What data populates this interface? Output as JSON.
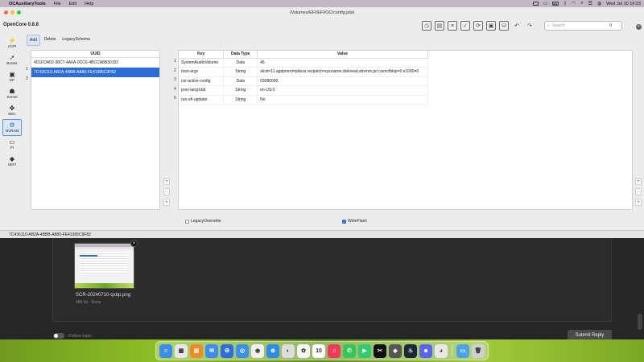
{
  "menubar": {
    "apple": "",
    "app_name": "OCAuxiliaryTools",
    "items": [
      "File",
      "Edit",
      "Help"
    ],
    "input_badge": "FR",
    "clock": "Wed Jul 10  19:23"
  },
  "window": {
    "title": "/Volumes/EFI/EFI/OC/config.plist",
    "app_title": "OpenCore 0.8.8",
    "search_placeholder": "Search",
    "search_count": "0"
  },
  "sidebar": {
    "items": [
      {
        "label": "ACPI",
        "icon": "lightning-icon",
        "active": false
      },
      {
        "label": "Booter",
        "icon": "rocket-icon",
        "active": false
      },
      {
        "label": "DP",
        "icon": "monitor-icon",
        "active": false
      },
      {
        "label": "Kernel",
        "icon": "person-icon",
        "active": false
      },
      {
        "label": "Misc",
        "icon": "misc-icon",
        "active": false
      },
      {
        "label": "NVRAM",
        "icon": "gear-icon",
        "active": true
      },
      {
        "label": "PI",
        "icon": "display-icon",
        "active": false
      },
      {
        "label": "UEFI",
        "icon": "cube-icon",
        "active": false
      }
    ]
  },
  "subtabs": [
    "Add",
    "Delete",
    "LegacySchema"
  ],
  "uuid_panel": {
    "header": "UUID",
    "rows": [
      {
        "num": "1",
        "uuid": "4D1FDA02-38C7-4A6A-9CC6-4BCCA8B30102",
        "selected": false
      },
      {
        "num": "2",
        "uuid": "7C436110-AB2A-4BBB-A880-FE41995C9F82",
        "selected": true
      }
    ]
  },
  "value_table": {
    "headers": {
      "key": "Key",
      "type": "Data Type",
      "value": "Value"
    },
    "rows": [
      {
        "num": "1",
        "key": "SystemAudioVolume",
        "type": "Data",
        "value": "46"
      },
      {
        "num": "2",
        "key": "boot-args",
        "type": "String",
        "value": "alcid=11 agdpmod=pikera revpatch=cpuname,diskread,sbvmm,pci vsmcfbkip=0 e1000=0"
      },
      {
        "num": "3",
        "key": "csr-active-config",
        "type": "Data",
        "value": "03080000"
      },
      {
        "num": "4",
        "key": "prev-lang:kbd",
        "type": "String",
        "value": "en-US:0"
      },
      {
        "num": "5",
        "key": "run-efi-updater",
        "type": "String",
        "value": "No"
      }
    ]
  },
  "buttons": {
    "add": "+",
    "remove": "-",
    "misc": "+"
  },
  "checkboxes": {
    "legacy_overwrite": {
      "label": "LegacyOverwrite",
      "checked": false
    },
    "write_flash": {
      "label": "WriteFlash",
      "checked": true
    }
  },
  "statusbar": {
    "text": "7C436110-AB2A-4BBB-A880-FE41995C9F82"
  },
  "compose": {
    "attachment_name": "SCR-20240710-qxbp.png",
    "attachment_meta": "489 kb · Done",
    "close": "×",
    "follow_label": "Follow topic",
    "submit_label": "Submit Reply"
  },
  "dock": {
    "apps": [
      {
        "name": "finder-icon",
        "color": "#3b8ee8",
        "glyph": "☺"
      },
      {
        "name": "launchpad-icon",
        "color": "#e8e8e8",
        "glyph": "▦"
      },
      {
        "name": "photos-grid-icon",
        "color": "#f08a24",
        "glyph": "▥"
      },
      {
        "name": "mail-icon",
        "color": "#3d8df0",
        "glyph": "✉"
      },
      {
        "name": "settings-icon",
        "color": "#2f6ed8",
        "glyph": "⚙"
      },
      {
        "name": "app-store-icon",
        "color": "#3a8ff0",
        "glyph": "◎"
      },
      {
        "name": "safari-alt-icon",
        "color": "#f0f0f0",
        "glyph": "◉"
      },
      {
        "name": "safari-icon",
        "color": "#2a8be8",
        "glyph": "⊕"
      },
      {
        "name": "chrome-alt-icon",
        "color": "#dddddd",
        "glyph": "◐"
      },
      {
        "name": "photos-icon",
        "color": "#f5f5f5",
        "glyph": "✿"
      },
      {
        "name": "calendar-icon",
        "color": "#ffffff",
        "glyph": "10"
      },
      {
        "name": "music-icon",
        "color": "#f03a5a",
        "glyph": "♫"
      },
      {
        "name": "messages-icon",
        "color": "#34c759",
        "glyph": "✆"
      },
      {
        "name": "facetime-icon",
        "color": "#2ecc71",
        "glyph": "▶"
      },
      {
        "name": "capcut-icon",
        "color": "#111111",
        "glyph": "✂"
      },
      {
        "name": "cpu-icon",
        "color": "#555555",
        "glyph": "◈"
      },
      {
        "name": "steam-icon",
        "color": "#1b2838",
        "glyph": "♨"
      },
      {
        "name": "discord-icon",
        "color": "#5865f2",
        "glyph": "☻"
      },
      {
        "name": "chrome-icon",
        "color": "#e8e8e8",
        "glyph": "◕"
      }
    ],
    "extras": [
      {
        "name": "folder-icon",
        "color": "#4ea3e8",
        "glyph": "▭"
      },
      {
        "name": "trash-icon",
        "color": "#cfcfcf",
        "glyph": "🗑"
      }
    ]
  }
}
